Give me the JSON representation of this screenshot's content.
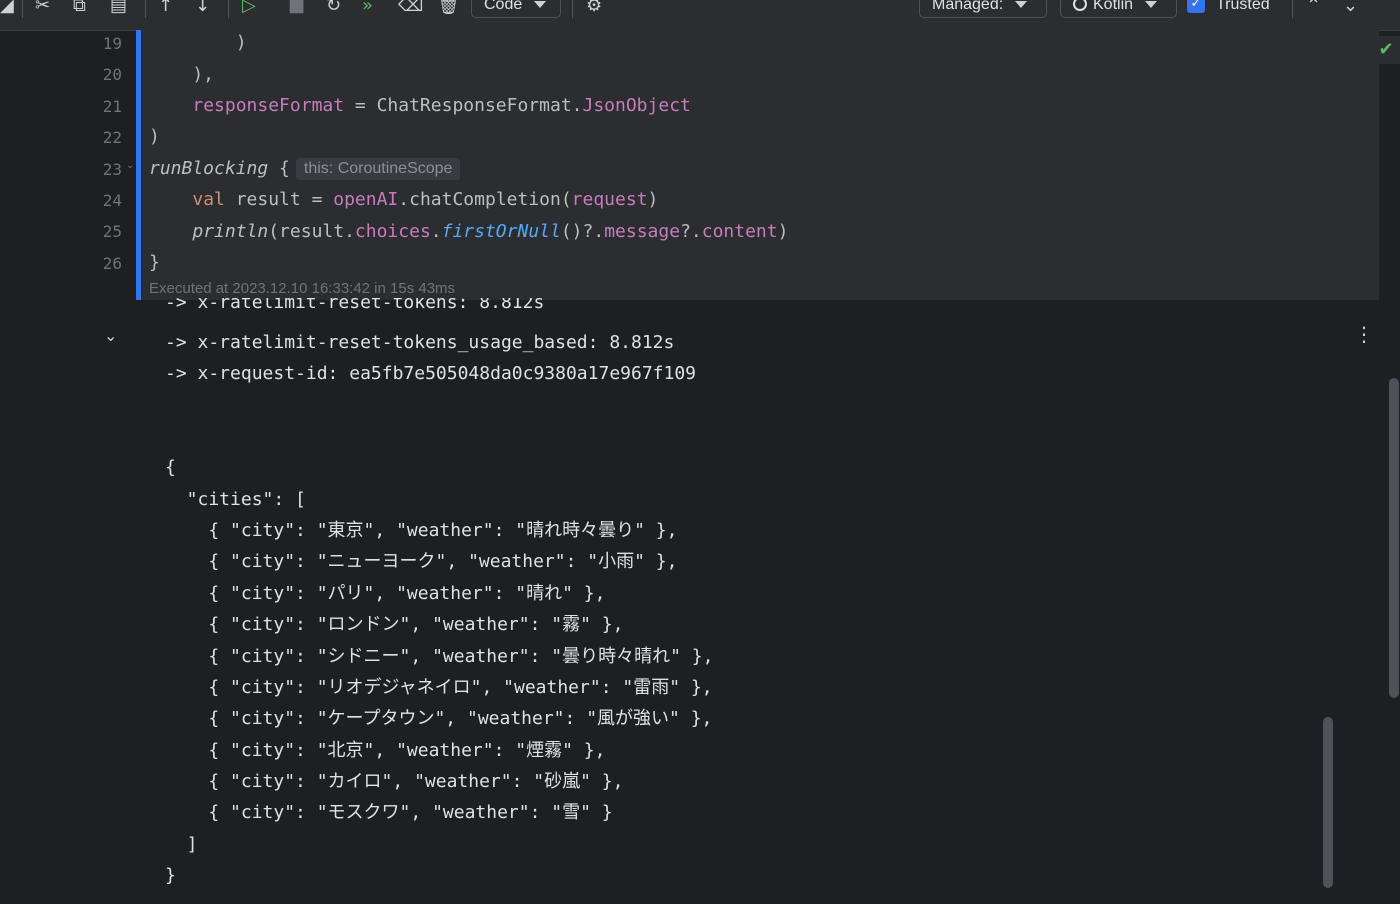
{
  "toolbar": {
    "code_select": "Code",
    "managed_select": "Managed:",
    "language_select": "Kotlin",
    "trusted_label": "Trusted",
    "trusted_checked": true,
    "icons": [
      "scissors-icon",
      "copy-icon",
      "paste-icon",
      "move-up-icon",
      "move-down-icon",
      "run-cell-icon",
      "stop-icon",
      "restart-icon",
      "run-all-icon",
      "clear-icon",
      "delete-icon",
      "settings-icon",
      "chevron-up-icon",
      "chevron-down-icon"
    ]
  },
  "editor": {
    "lines": [
      {
        "num": "19",
        "code": "        )"
      },
      {
        "num": "20",
        "code": "    ),"
      },
      {
        "num": "21",
        "code": "    responseFormat = ChatResponseFormat.JsonObject"
      },
      {
        "num": "22",
        "code": ")"
      },
      {
        "num": "23",
        "code": "runBlocking {"
      },
      {
        "num": "24",
        "code": "    val result = openAI.chatCompletion(request)"
      },
      {
        "num": "25",
        "code": "    println(result.choices.firstOrNull()?.message?.content)"
      },
      {
        "num": "26",
        "code": "}"
      }
    ],
    "inlay_hint": "this: CoroutineScope",
    "executed_status": "Executed at 2023.12.10 16:33:42 in 15s 43ms",
    "status_icon": "check-icon",
    "accent_color": "#3574f0"
  },
  "output": {
    "cut_line": "-> x-ratelimit-reset-tokens: 8.812s",
    "lines": [
      "-> x-ratelimit-reset-tokens_usage_based: 8.812s",
      "-> x-request-id: ea5fb7e505048da0c9380a17e967f109",
      "",
      "",
      "{",
      "  \"cities\": [",
      "    { \"city\": \"東京\", \"weather\": \"晴れ時々曇り\" },",
      "    { \"city\": \"ニューヨーク\", \"weather\": \"小雨\" },",
      "    { \"city\": \"パリ\", \"weather\": \"晴れ\" },",
      "    { \"city\": \"ロンドン\", \"weather\": \"霧\" },",
      "    { \"city\": \"シドニー\", \"weather\": \"曇り時々晴れ\" },",
      "    { \"city\": \"リオデジャネイロ\", \"weather\": \"雷雨\" },",
      "    { \"city\": \"ケープタウン\", \"weather\": \"風が強い\" },",
      "    { \"city\": \"北京\", \"weather\": \"煙霧\" },",
      "    { \"city\": \"カイロ\", \"weather\": \"砂嵐\" },",
      "    { \"city\": \"モスクワ\", \"weather\": \"雪\" }",
      "  ]",
      "}"
    ]
  }
}
